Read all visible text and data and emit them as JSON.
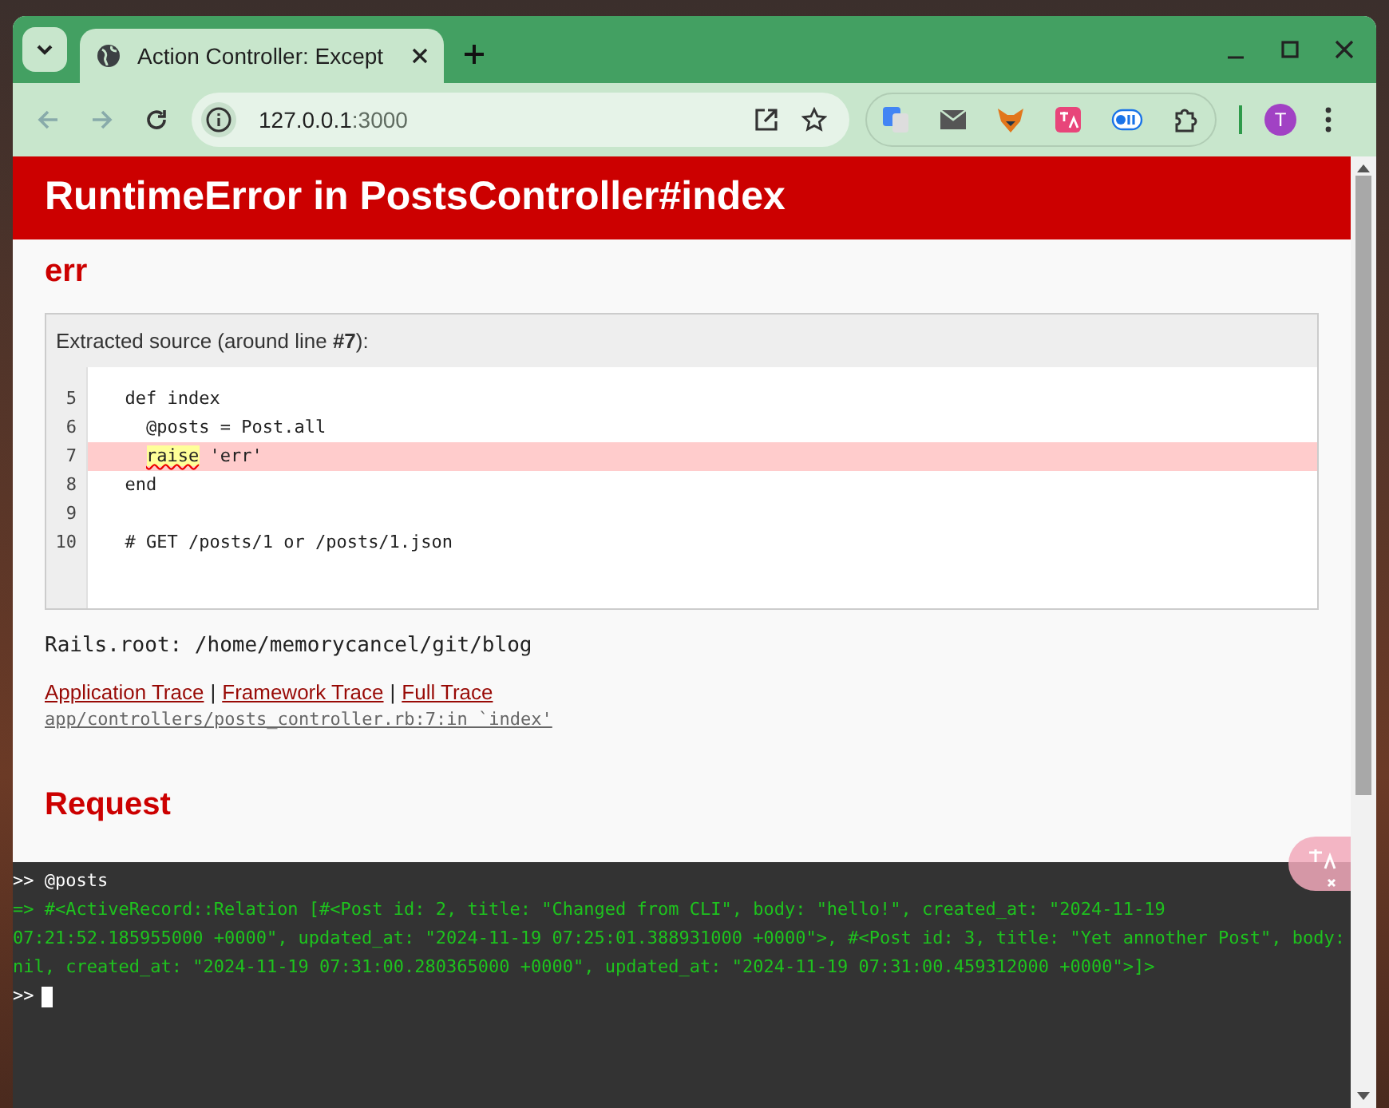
{
  "browser": {
    "tab_title": "Action Controller: Except",
    "url_host": "127.0.0.1",
    "url_port": ":3000",
    "profile_initial": "T"
  },
  "page": {
    "heading": "RuntimeError in PostsController#index",
    "message": "err",
    "source": {
      "caption": "Extracted source (around line **#7**):",
      "lines": [
        {
          "number": "5",
          "code": "  def index",
          "selected": false
        },
        {
          "number": "6",
          "code": "    @posts = Post.all",
          "selected": false
        },
        {
          "number": "7",
          "code": "    raise 'err'",
          "selected": true
        },
        {
          "number": "8",
          "code": "  end",
          "selected": false
        },
        {
          "number": "9",
          "selected": false
        },
        {
          "number": "10",
          "code": "  # GET /posts/1 or /posts/1.json",
          "selected": false
        }
      ]
    },
    "rails_root": "Rails.root: /home/memorycancel/git/blog",
    "trace_links": [
      {
        "label": "Application Trace"
      },
      {
        "label": "Framework Trace"
      },
      {
        "label": "Full Trace"
      }
    ],
    "trace_separator": "|",
    "trace_line": "app/controllers/posts_controller.rb:7:in `index'",
    "section_heading": "Request"
  },
  "console": {
    "lines": [
      {
        "kind": "input",
        "prompt": ">>",
        "text": "@posts"
      },
      {
        "kind": "output",
        "prompt": "=>",
        "text": "#<ActiveRecord::Relation [#<Post id: 2, title: \"Changed from CLI\", body: \"hello!\", created_at: \"2024-11-19 07:21:52.185955000 +0000\", updated_at: \"2024-11-19 07:25:01.388931000 +0000\">, #<Post id: 3, title: \"Yet annother Post\", body: nil, created_at: \"2024-11-19 07:31:00.280365000 +0000\", updated_at: \"2024-11-19 07:31:00.459312000 +0000\">]>"
      },
      {
        "kind": "prompt",
        "prompt": ">>"
      }
    ]
  }
}
